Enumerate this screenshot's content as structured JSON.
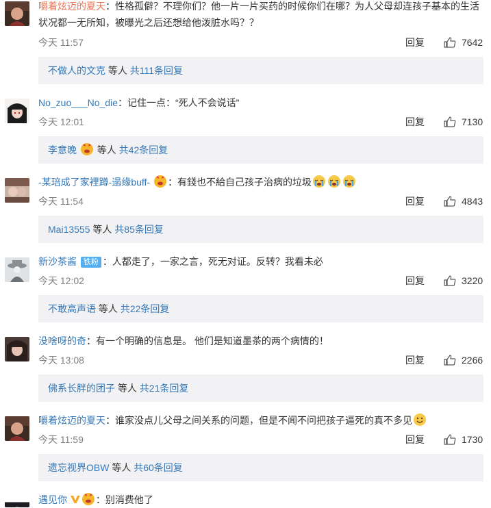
{
  "comments": [
    {
      "username": "嚼着炫迈的夏天",
      "text": "性格孤僻？不理你们？他一片一片买药的时候你们在哪？为人父母却连孩子基本的生活状况都一无所知，被曝光之后还想给他泼脏水吗？？",
      "time": "今天 11:57",
      "reply_label": "回复",
      "likes": "7642",
      "reply_preview": {
        "user": "不做人的文克",
        "etc": "等人",
        "count": "共111条回复"
      }
    },
    {
      "username": "No_zuo___No_die",
      "text": "记住一点：“死人不会说话”",
      "time": "今天 12:01",
      "reply_label": "回复",
      "likes": "7130",
      "reply_preview": {
        "user": "李意晚",
        "etc": "等人",
        "count": "共42条回复"
      }
    },
    {
      "username": "-某琣成了家裡蹲-遢缘buff-",
      "text": "有錢也不給自己孩子治病的垃圾",
      "time": "今天 11:54",
      "reply_label": "回复",
      "likes": "4843",
      "reply_preview": {
        "user": "Mai13555",
        "etc": "等人",
        "count": "共85条回复"
      }
    },
    {
      "username": "新沙茶酱",
      "badge": "铁粉",
      "text": "人都走了，一家之言，死无对证。反转？我看未必",
      "time": "今天 12:02",
      "reply_label": "回复",
      "likes": "3220",
      "reply_preview": {
        "user": "不敢高声语",
        "etc": "等人",
        "count": "共22条回复"
      }
    },
    {
      "username": "没啥呀的奇",
      "text": "有一个明确的信息是。 他们是知道墨茶的两个病情的！",
      "time": "今天 13:08",
      "reply_label": "回复",
      "likes": "2266",
      "reply_preview": {
        "user": "佛系长胖的团子",
        "etc": "等人",
        "count": "共21条回复"
      }
    },
    {
      "username": "嚼着炫迈的夏天",
      "text": "谁家没点儿父母之间关系的问题，但是不闻不问把孩子逼死的真不多见",
      "time": "今天 11:59",
      "reply_label": "回复",
      "likes": "1730",
      "reply_preview": {
        "user": "遗忘视界OBW",
        "etc": "等人",
        "count": "共60条回复"
      }
    },
    {
      "username": "遇见你",
      "text": "别消费他了"
    }
  ],
  "colors": {
    "username": "#eb7350",
    "link_blue": "#3478b8",
    "reply_box_bg": "#f2f2f5",
    "time_gray": "#808080",
    "fan_badge": "#56aef0"
  },
  "icons": {
    "like": "thumbs-up-icon",
    "emoji_cry": "crying-face-emoji",
    "emoji_smile": "smiling-face-emoji",
    "emoji_heart_face": "heart-face-emoji",
    "vip": "yellow-v-icon"
  }
}
